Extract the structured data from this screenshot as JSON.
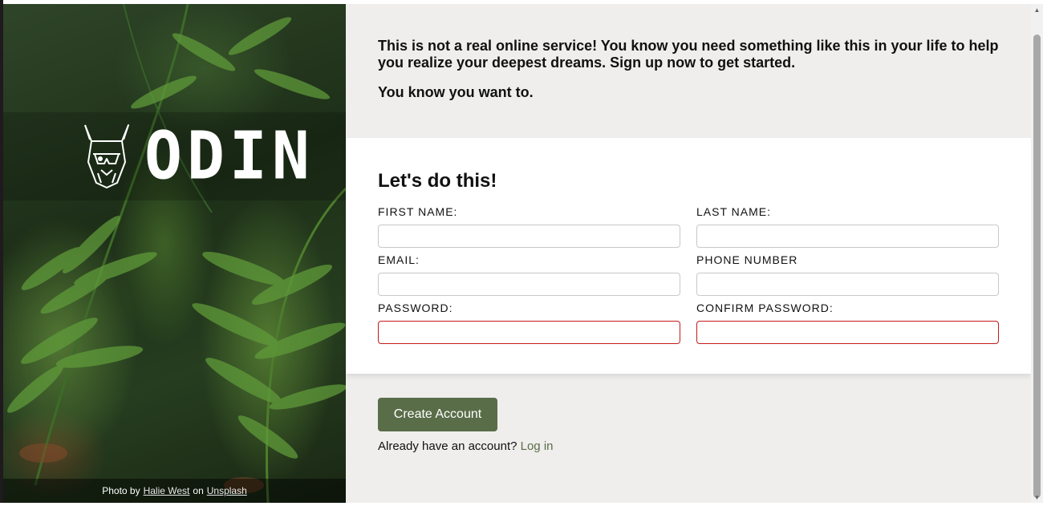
{
  "hero": {
    "logo_text": "ODIN",
    "logo_icon": "viking-helmet-icon",
    "credit_prefix": "Photo by",
    "credit_author": "Halie West",
    "credit_on": "on",
    "credit_site": "Unsplash"
  },
  "intro": {
    "paragraph1": "This is not a real online service! You know you need something like this in your life to help you realize your deepest dreams. Sign up now to get started.",
    "paragraph2": "You know you want to."
  },
  "form": {
    "title": "Let's do this!",
    "fields": [
      {
        "label": "FIRST NAME:",
        "value": "",
        "invalid": false
      },
      {
        "label": "LAST NAME:",
        "value": "",
        "invalid": false
      },
      {
        "label": "EMAIL:",
        "value": "",
        "invalid": false
      },
      {
        "label": "PHONE NUMBER",
        "value": "",
        "invalid": false
      },
      {
        "label": "PASSWORD:",
        "value": "",
        "invalid": true
      },
      {
        "label": "CONFIRM PASSWORD:",
        "value": "",
        "invalid": true
      }
    ]
  },
  "actions": {
    "create_label": "Create Account",
    "login_prompt": "Already have an account?",
    "login_link": "Log in"
  },
  "colors": {
    "accent": "#596d48",
    "invalid_border": "#c51a1a",
    "panel_bg": "#efeeec",
    "card_bg": "#ffffff"
  }
}
